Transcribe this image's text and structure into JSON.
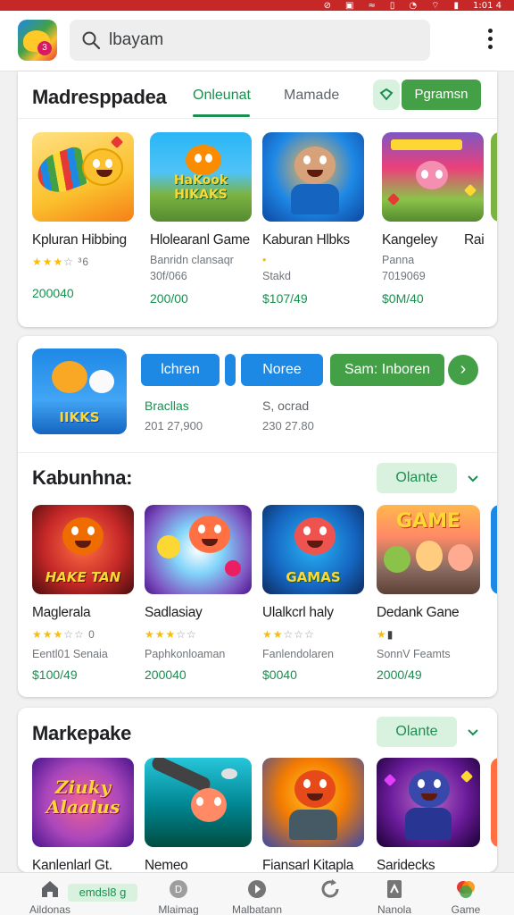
{
  "status_bar": {
    "time": "1:01 4"
  },
  "search": {
    "query": "lbayam"
  },
  "section1": {
    "title": "Madresppadea",
    "tabs": [
      {
        "label": "Onleunat",
        "active": true
      },
      {
        "label": "Mamade",
        "active": false
      }
    ],
    "button": "Pgramsn",
    "apps": [
      {
        "name": "Kpluran Hibbing",
        "stars": 3,
        "sub": "³6",
        "price": "200040"
      },
      {
        "name": "Hlolearanl Game",
        "sub": "Banridn clansaqr",
        "sub2": "30f/066",
        "price": "200/00"
      },
      {
        "name": "Kaburan Hlbks",
        "sub": "•",
        "sub2": "Stakd",
        "price": "$107/49"
      },
      {
        "name": "Kangeley",
        "sub": "Panna",
        "sub2": "7019069",
        "price": "$0M/40"
      },
      {
        "name": "Rai"
      }
    ],
    "thumb_words": [
      "",
      "HaKook HIKAKS",
      "",
      ""
    ]
  },
  "featured": {
    "thumb_word": "IIKKS",
    "buttons": [
      "lchren",
      "Noree",
      "Sam: Inboren"
    ],
    "meta": [
      {
        "label": "Bracllas",
        "value": "201 27,900"
      },
      {
        "label": "S, ocrad",
        "value": "230 27.80"
      }
    ]
  },
  "section2": {
    "title": "Kabunhna:",
    "button": "Olante",
    "apps": [
      {
        "name": "Maglerala",
        "stars": 3,
        "sub": "Eentl01 Senaia",
        "price": "$100/49",
        "word": "HAKE TAN"
      },
      {
        "name": "Sadlasiay",
        "stars": 3,
        "sub": "Paphkonloaman",
        "price": "200040",
        "word": ""
      },
      {
        "name": "Ulalkcrl haly",
        "stars": 2,
        "sub": "Fanlendolaren",
        "price": "$0040",
        "word": "GAMAS"
      },
      {
        "name": "Dedank Gane",
        "stars": 1,
        "sub": "SonnV Feamts",
        "price": "2000/49",
        "word": "GAME"
      }
    ]
  },
  "section3": {
    "title": "Markepake",
    "button": "Olante",
    "apps": [
      {
        "name": "Kanlenlarl Gt.",
        "word": "Ziuky Alaalus"
      },
      {
        "name": "Nemeo",
        "word": ""
      },
      {
        "name": "Fiansarl Kitapla",
        "word": ""
      },
      {
        "name": "Saridecks",
        "word": ""
      }
    ]
  },
  "bottom_nav": [
    {
      "label": "Aildonas",
      "icon": "home-icon"
    },
    {
      "label": "Mlaimag",
      "icon": "disc-icon"
    },
    {
      "label": "Malbatann",
      "icon": "play-icon"
    },
    {
      "label": "",
      "icon": "refresh-icon"
    },
    {
      "label": "Nanola",
      "icon": "book-icon"
    },
    {
      "label": "Game",
      "icon": "game-icon"
    }
  ],
  "nav_chip": "emdsl8 g",
  "colors": {
    "accent_green": "#1a8f4f",
    "button_green": "#43a047",
    "button_blue": "#1e88e5",
    "status_red": "#c62828"
  }
}
